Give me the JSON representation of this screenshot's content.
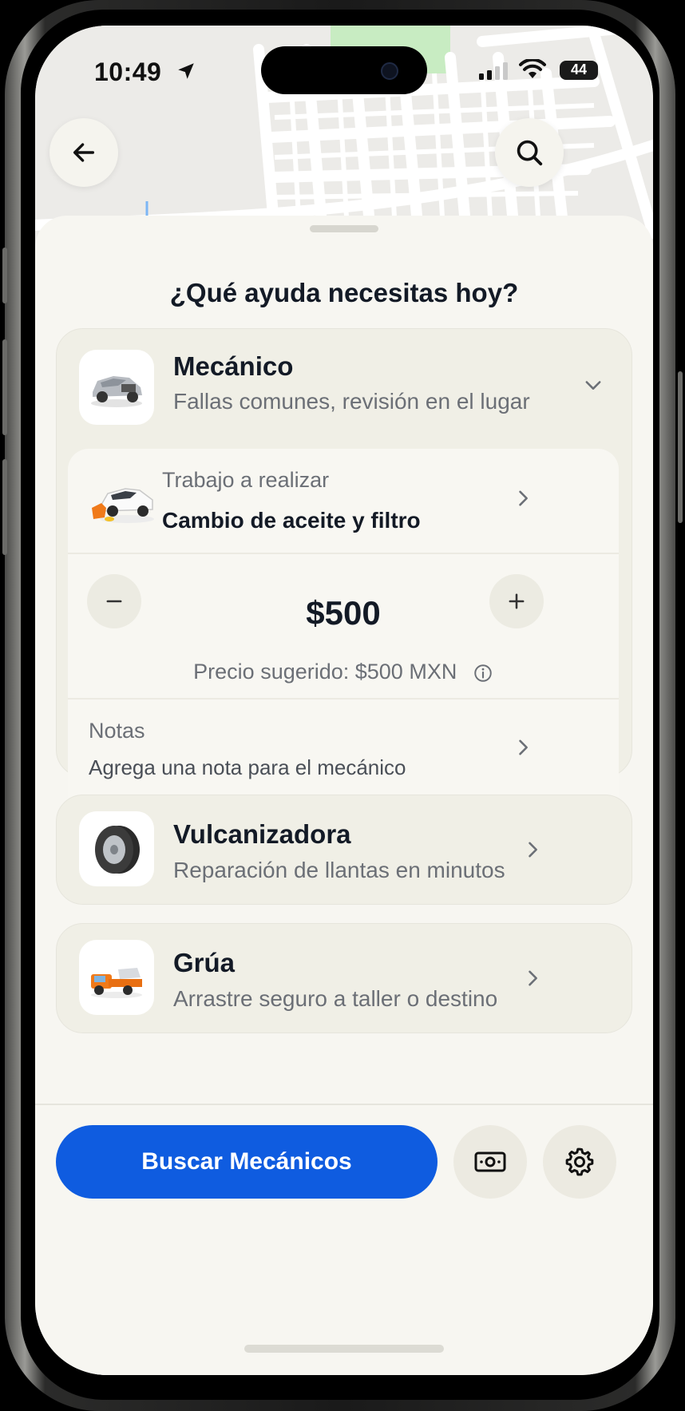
{
  "status_bar": {
    "time": "10:49",
    "battery": "44"
  },
  "colors": {
    "accent": "#0f5ce0",
    "sheet_bg": "#f7f6f1",
    "card_bg": "#f0efe6",
    "text_primary": "#131a26",
    "text_secondary": "#6b6f76"
  },
  "header": {
    "back_icon": "arrow-left-icon",
    "search_icon": "search-icon"
  },
  "sheet": {
    "title": "¿Qué ayuda necesitas hoy?"
  },
  "services": {
    "mechanic": {
      "title": "Mecánico",
      "subtitle": "Fallas comunes, revisión en el lugar",
      "icon": "car-chassis-icon",
      "expanded": true,
      "job": {
        "label": "Trabajo a realizar",
        "value": "Cambio de aceite y filtro",
        "icon": "car-oil-icon"
      },
      "price": {
        "value": "$500",
        "suggested": "Precio sugerido: $500 MXN"
      },
      "notes": {
        "label": "Notas",
        "placeholder": "Agrega una nota para el mecánico"
      }
    },
    "tire": {
      "title": "Vulcanizadora",
      "subtitle": "Reparación de llantas en minutos",
      "icon": "tire-icon"
    },
    "tow": {
      "title": "Grúa",
      "subtitle": "Arrastre seguro a taller o destino",
      "icon": "tow-truck-icon"
    }
  },
  "footer": {
    "cta_label": "Buscar Mecánicos",
    "payment_icon": "cash-icon",
    "settings_icon": "gear-icon"
  }
}
